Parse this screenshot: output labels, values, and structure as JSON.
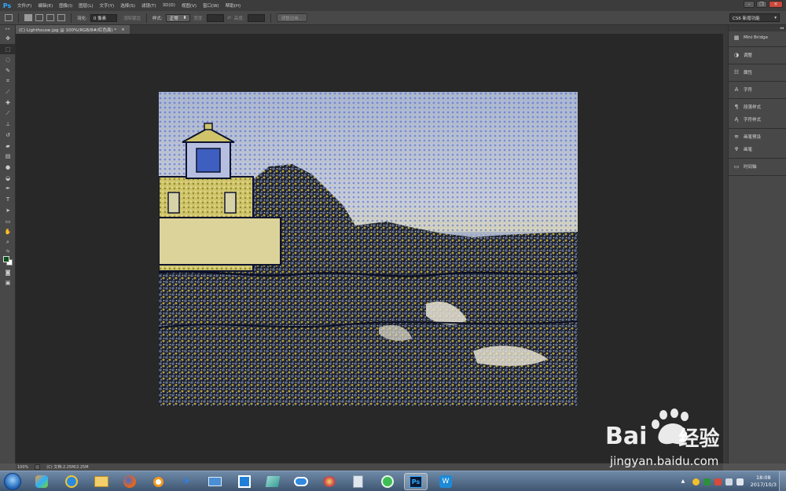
{
  "app": {
    "logo": "Ps",
    "menu": [
      "文件(F)",
      "编辑(E)",
      "图像(I)",
      "图层(L)",
      "文字(Y)",
      "选择(S)",
      "滤镜(T)",
      "3D(D)",
      "视图(V)",
      "窗口(W)",
      "帮助(H)"
    ],
    "window_controls": {
      "minimize": "–",
      "restore": "❐",
      "close": "✕"
    }
  },
  "options": {
    "feather_label": "羽化:",
    "feather_value": "0 像素",
    "antialias_label": "消除锯齿",
    "style_label": "样式:",
    "style_value": "正常",
    "width_label": "宽度:",
    "height_label": "高度:",
    "refine_edge": "调整边缘...",
    "workspace": "CS6 新增功能"
  },
  "document": {
    "tab_title": "(C) Lighthouse.jpg @ 100%(RGB/8#/红色面) *",
    "tab_close": "×"
  },
  "status": {
    "zoom": "100%",
    "doc_info": "(C) 文档:2.25M/2.25M"
  },
  "dock": {
    "collapse": "◂◂",
    "groups": [
      [
        {
          "icon": "bridge-icon",
          "glyph": "▦",
          "label": "Mini Bridge"
        }
      ],
      [
        {
          "icon": "adjustments-icon",
          "glyph": "◑",
          "label": "调整"
        }
      ],
      [
        {
          "icon": "properties-icon",
          "glyph": "☷",
          "label": "属性"
        }
      ],
      [
        {
          "icon": "character-icon",
          "glyph": "A",
          "label": "字符"
        }
      ],
      [
        {
          "icon": "paragraph-style-icon",
          "glyph": "¶",
          "label": "段落样式"
        },
        {
          "icon": "character-style-icon",
          "glyph": "Ą",
          "label": "字符样式"
        }
      ],
      [
        {
          "icon": "brush-presets-icon",
          "glyph": "≋",
          "label": "画笔预设"
        },
        {
          "icon": "brush-icon",
          "glyph": "♆",
          "label": "画笔"
        }
      ],
      [
        {
          "icon": "timeline-icon",
          "glyph": "▭",
          "label": "时间轴"
        }
      ]
    ]
  },
  "taskbar": {
    "time": "18:08",
    "date": "2017/10/3",
    "ps_label": "Ps"
  },
  "watermark": {
    "brand": "Bai",
    "brand2": "经验",
    "url": "jingyan.baidu.com"
  }
}
